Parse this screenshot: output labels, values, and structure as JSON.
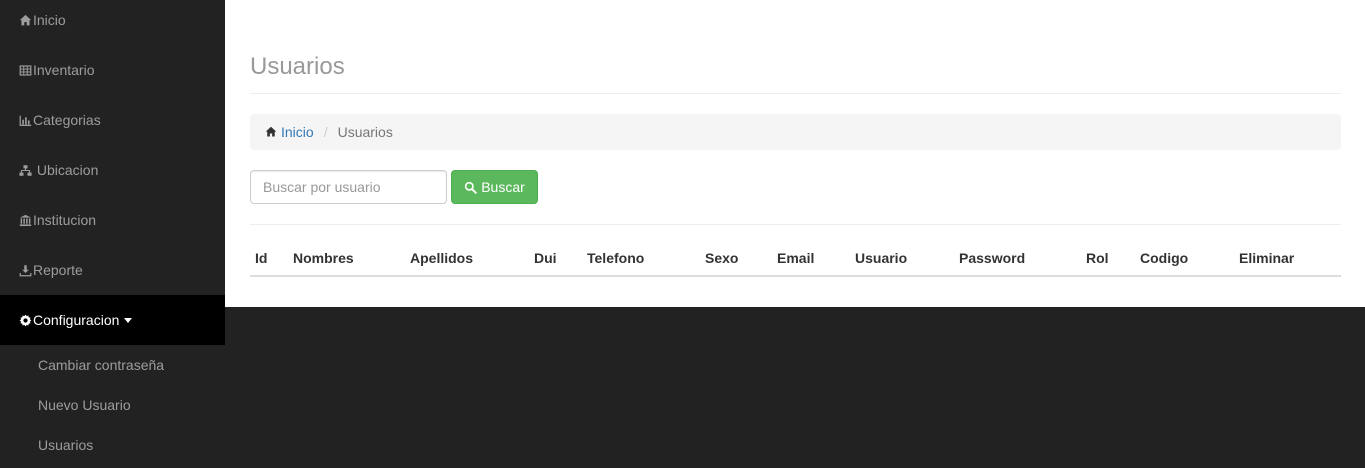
{
  "sidebar": {
    "items": [
      {
        "label": "Inicio",
        "icon": "home-icon"
      },
      {
        "label": "Inventario",
        "icon": "table-icon"
      },
      {
        "label": "Categorias",
        "icon": "bar-chart-icon"
      },
      {
        "label": " Ubicacion",
        "icon": "sitemap-icon"
      },
      {
        "label": "Institucion",
        "icon": "bank-icon"
      },
      {
        "label": "Reporte",
        "icon": "download-icon"
      },
      {
        "label": "Configuracion",
        "icon": "gear-icon",
        "active": true
      }
    ],
    "submenu": [
      {
        "label": "Cambiar contraseña"
      },
      {
        "label": "Nuevo Usuario"
      },
      {
        "label": "Usuarios"
      }
    ]
  },
  "main": {
    "title": "Usuarios",
    "breadcrumb": {
      "home_label": "Inicio",
      "current_label": "Usuarios",
      "separator": "/"
    },
    "search": {
      "placeholder": "Buscar por usuario",
      "value": "",
      "button_label": "Buscar"
    },
    "table": {
      "columns": [
        "Id",
        "Nombres",
        "Apellidos",
        "Dui",
        "Telefono",
        "Sexo",
        "Email",
        "Usuario",
        "Password",
        "Rol",
        "Codigo",
        "Eliminar"
      ],
      "rows": []
    }
  },
  "colors": {
    "sidebar_bg": "#222222",
    "sidebar_active_bg": "#000000",
    "link": "#337ab7",
    "success": "#5cb85c"
  }
}
